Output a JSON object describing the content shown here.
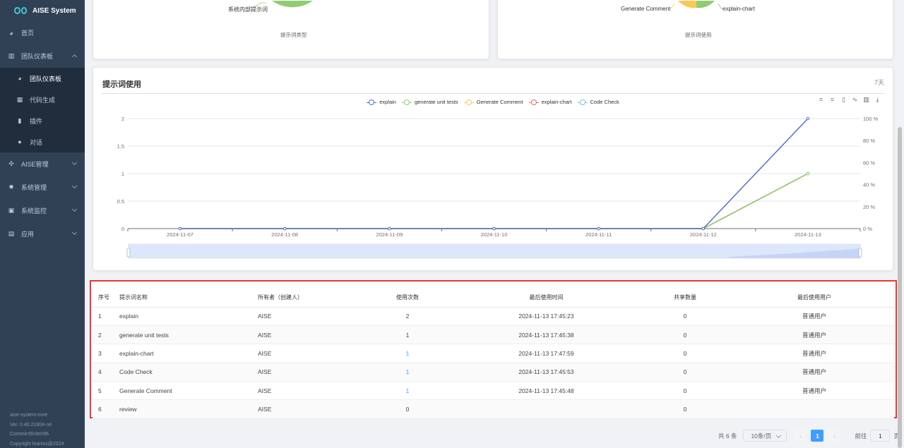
{
  "sidebar": {
    "brand": "AISE System",
    "items": [
      {
        "label": "首页",
        "icon": "dashboard-icon",
        "key": "home"
      },
      {
        "label": "团队仪表板",
        "icon": "bar-chart-icon",
        "key": "team-dashboard",
        "expanded": true
      }
    ],
    "subitems": [
      {
        "label": "团队仪表板",
        "icon": "dashboard-icon",
        "key": "team-dashboard-sub",
        "active": true
      },
      {
        "label": "代码生成",
        "icon": "code-icon",
        "key": "code-gen"
      },
      {
        "label": "插件",
        "icon": "plugin-icon",
        "key": "plugin"
      },
      {
        "label": "对话",
        "icon": "chat-icon",
        "key": "chat"
      }
    ],
    "items_after": [
      {
        "label": "AISE管理",
        "icon": "puzzle-icon",
        "key": "aise-admin"
      },
      {
        "label": "系统管理",
        "icon": "gear-icon",
        "key": "system-admin"
      },
      {
        "label": "系统监控",
        "icon": "monitor-icon",
        "key": "system-monitor"
      },
      {
        "label": "应用",
        "icon": "app-icon",
        "key": "apps"
      }
    ],
    "footer": {
      "name": "aise-system-core",
      "version": "Ver. 0.40.21804-rel",
      "commit": "Commit:6fc0e096",
      "copyright": "Copyright leaniss@2024"
    }
  },
  "top_cards": {
    "left": {
      "pie_label": "系统内部提示词",
      "caption": "提示词类型"
    },
    "right": {
      "pie_label_1": "Generate Comment",
      "pie_label_2": "explain-chart",
      "caption": "提示词使用"
    }
  },
  "usage_chart": {
    "title": "提示词使用",
    "range": "7天"
  },
  "chart_data": {
    "type": "line",
    "x": [
      "2024-11-07",
      "2024-11-08",
      "2024-11-09",
      "2024-11-10",
      "2024-11-11",
      "2024-11-12",
      "2024-11-13"
    ],
    "series": [
      {
        "name": "explain",
        "values": [
          0,
          0,
          0,
          0,
          0,
          0,
          2
        ],
        "color": "#5470c6"
      },
      {
        "name": "generate unit tests",
        "values": [
          0,
          0,
          0,
          0,
          0,
          0,
          1
        ],
        "color": "#91cc75"
      },
      {
        "name": "Generate Comment",
        "values": [
          0,
          0,
          0,
          0,
          0,
          0,
          1
        ],
        "color": "#fac858"
      },
      {
        "name": "explain-chart",
        "values": [
          0,
          0,
          0,
          0,
          0,
          0,
          1
        ],
        "color": "#ee6666"
      },
      {
        "name": "Code Check",
        "values": [
          0,
          0,
          0,
          0,
          0,
          0,
          1
        ],
        "color": "#73c0de"
      }
    ],
    "y_ticks": [
      "0",
      "0.5",
      "1",
      "1.5",
      "2"
    ],
    "ylim": [
      0,
      2
    ],
    "y2_ticks": [
      "0 %",
      "20 %",
      "40 %",
      "60 %",
      "80 %",
      "100 %"
    ],
    "legend_position": "top-center",
    "grid": true
  },
  "table": {
    "headers": [
      "序号",
      "提示词名称",
      "所有者（创建人）",
      "使用次数",
      "最后使用时间",
      "共享数量",
      "最后使用用户"
    ],
    "rows": [
      [
        "1",
        "explain",
        "AISE",
        "2",
        "2024-11-13 17:45:23",
        "0",
        "普通用户"
      ],
      [
        "2",
        "generate unit tests",
        "AISE",
        "1",
        "2024-11-13 17:45:38",
        "0",
        "普通用户"
      ],
      [
        "3",
        "explain-chart",
        "AISE",
        "1",
        "2024-11-13 17:47:59",
        "0",
        "普通用户"
      ],
      [
        "4",
        "Code Check",
        "AISE",
        "1",
        "2024-11-13 17:45:53",
        "0",
        "普通用户"
      ],
      [
        "5",
        "Generate Comment",
        "AISE",
        "1",
        "2024-11-13 17:45:48",
        "0",
        "普通用户"
      ],
      [
        "6",
        "review",
        "AISE",
        "0",
        "",
        "0",
        ""
      ]
    ]
  },
  "pagination": {
    "total": "共 6 条",
    "page_size": "10条/页",
    "current_page": "1",
    "goto_label": "前往",
    "goto_value": "1",
    "page_suffix": "页"
  }
}
